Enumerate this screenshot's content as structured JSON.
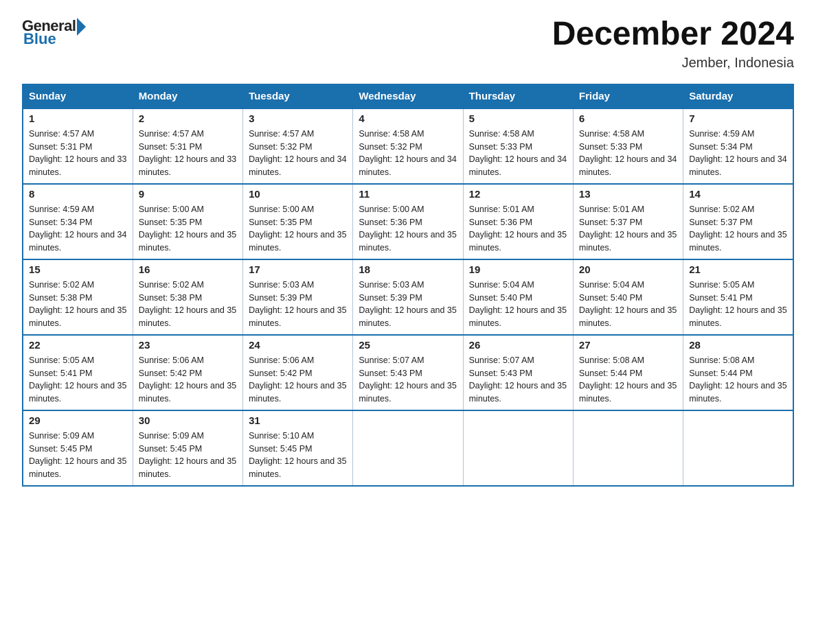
{
  "logo": {
    "general": "General",
    "blue": "Blue"
  },
  "header": {
    "title": "December 2024",
    "location": "Jember, Indonesia"
  },
  "days_of_week": [
    "Sunday",
    "Monday",
    "Tuesday",
    "Wednesday",
    "Thursday",
    "Friday",
    "Saturday"
  ],
  "weeks": [
    [
      {
        "day": "1",
        "sunrise": "4:57 AM",
        "sunset": "5:31 PM",
        "daylight": "12 hours and 33 minutes."
      },
      {
        "day": "2",
        "sunrise": "4:57 AM",
        "sunset": "5:31 PM",
        "daylight": "12 hours and 33 minutes."
      },
      {
        "day": "3",
        "sunrise": "4:57 AM",
        "sunset": "5:32 PM",
        "daylight": "12 hours and 34 minutes."
      },
      {
        "day": "4",
        "sunrise": "4:58 AM",
        "sunset": "5:32 PM",
        "daylight": "12 hours and 34 minutes."
      },
      {
        "day": "5",
        "sunrise": "4:58 AM",
        "sunset": "5:33 PM",
        "daylight": "12 hours and 34 minutes."
      },
      {
        "day": "6",
        "sunrise": "4:58 AM",
        "sunset": "5:33 PM",
        "daylight": "12 hours and 34 minutes."
      },
      {
        "day": "7",
        "sunrise": "4:59 AM",
        "sunset": "5:34 PM",
        "daylight": "12 hours and 34 minutes."
      }
    ],
    [
      {
        "day": "8",
        "sunrise": "4:59 AM",
        "sunset": "5:34 PM",
        "daylight": "12 hours and 34 minutes."
      },
      {
        "day": "9",
        "sunrise": "5:00 AM",
        "sunset": "5:35 PM",
        "daylight": "12 hours and 35 minutes."
      },
      {
        "day": "10",
        "sunrise": "5:00 AM",
        "sunset": "5:35 PM",
        "daylight": "12 hours and 35 minutes."
      },
      {
        "day": "11",
        "sunrise": "5:00 AM",
        "sunset": "5:36 PM",
        "daylight": "12 hours and 35 minutes."
      },
      {
        "day": "12",
        "sunrise": "5:01 AM",
        "sunset": "5:36 PM",
        "daylight": "12 hours and 35 minutes."
      },
      {
        "day": "13",
        "sunrise": "5:01 AM",
        "sunset": "5:37 PM",
        "daylight": "12 hours and 35 minutes."
      },
      {
        "day": "14",
        "sunrise": "5:02 AM",
        "sunset": "5:37 PM",
        "daylight": "12 hours and 35 minutes."
      }
    ],
    [
      {
        "day": "15",
        "sunrise": "5:02 AM",
        "sunset": "5:38 PM",
        "daylight": "12 hours and 35 minutes."
      },
      {
        "day": "16",
        "sunrise": "5:02 AM",
        "sunset": "5:38 PM",
        "daylight": "12 hours and 35 minutes."
      },
      {
        "day": "17",
        "sunrise": "5:03 AM",
        "sunset": "5:39 PM",
        "daylight": "12 hours and 35 minutes."
      },
      {
        "day": "18",
        "sunrise": "5:03 AM",
        "sunset": "5:39 PM",
        "daylight": "12 hours and 35 minutes."
      },
      {
        "day": "19",
        "sunrise": "5:04 AM",
        "sunset": "5:40 PM",
        "daylight": "12 hours and 35 minutes."
      },
      {
        "day": "20",
        "sunrise": "5:04 AM",
        "sunset": "5:40 PM",
        "daylight": "12 hours and 35 minutes."
      },
      {
        "day": "21",
        "sunrise": "5:05 AM",
        "sunset": "5:41 PM",
        "daylight": "12 hours and 35 minutes."
      }
    ],
    [
      {
        "day": "22",
        "sunrise": "5:05 AM",
        "sunset": "5:41 PM",
        "daylight": "12 hours and 35 minutes."
      },
      {
        "day": "23",
        "sunrise": "5:06 AM",
        "sunset": "5:42 PM",
        "daylight": "12 hours and 35 minutes."
      },
      {
        "day": "24",
        "sunrise": "5:06 AM",
        "sunset": "5:42 PM",
        "daylight": "12 hours and 35 minutes."
      },
      {
        "day": "25",
        "sunrise": "5:07 AM",
        "sunset": "5:43 PM",
        "daylight": "12 hours and 35 minutes."
      },
      {
        "day": "26",
        "sunrise": "5:07 AM",
        "sunset": "5:43 PM",
        "daylight": "12 hours and 35 minutes."
      },
      {
        "day": "27",
        "sunrise": "5:08 AM",
        "sunset": "5:44 PM",
        "daylight": "12 hours and 35 minutes."
      },
      {
        "day": "28",
        "sunrise": "5:08 AM",
        "sunset": "5:44 PM",
        "daylight": "12 hours and 35 minutes."
      }
    ],
    [
      {
        "day": "29",
        "sunrise": "5:09 AM",
        "sunset": "5:45 PM",
        "daylight": "12 hours and 35 minutes."
      },
      {
        "day": "30",
        "sunrise": "5:09 AM",
        "sunset": "5:45 PM",
        "daylight": "12 hours and 35 minutes."
      },
      {
        "day": "31",
        "sunrise": "5:10 AM",
        "sunset": "5:45 PM",
        "daylight": "12 hours and 35 minutes."
      },
      null,
      null,
      null,
      null
    ]
  ]
}
